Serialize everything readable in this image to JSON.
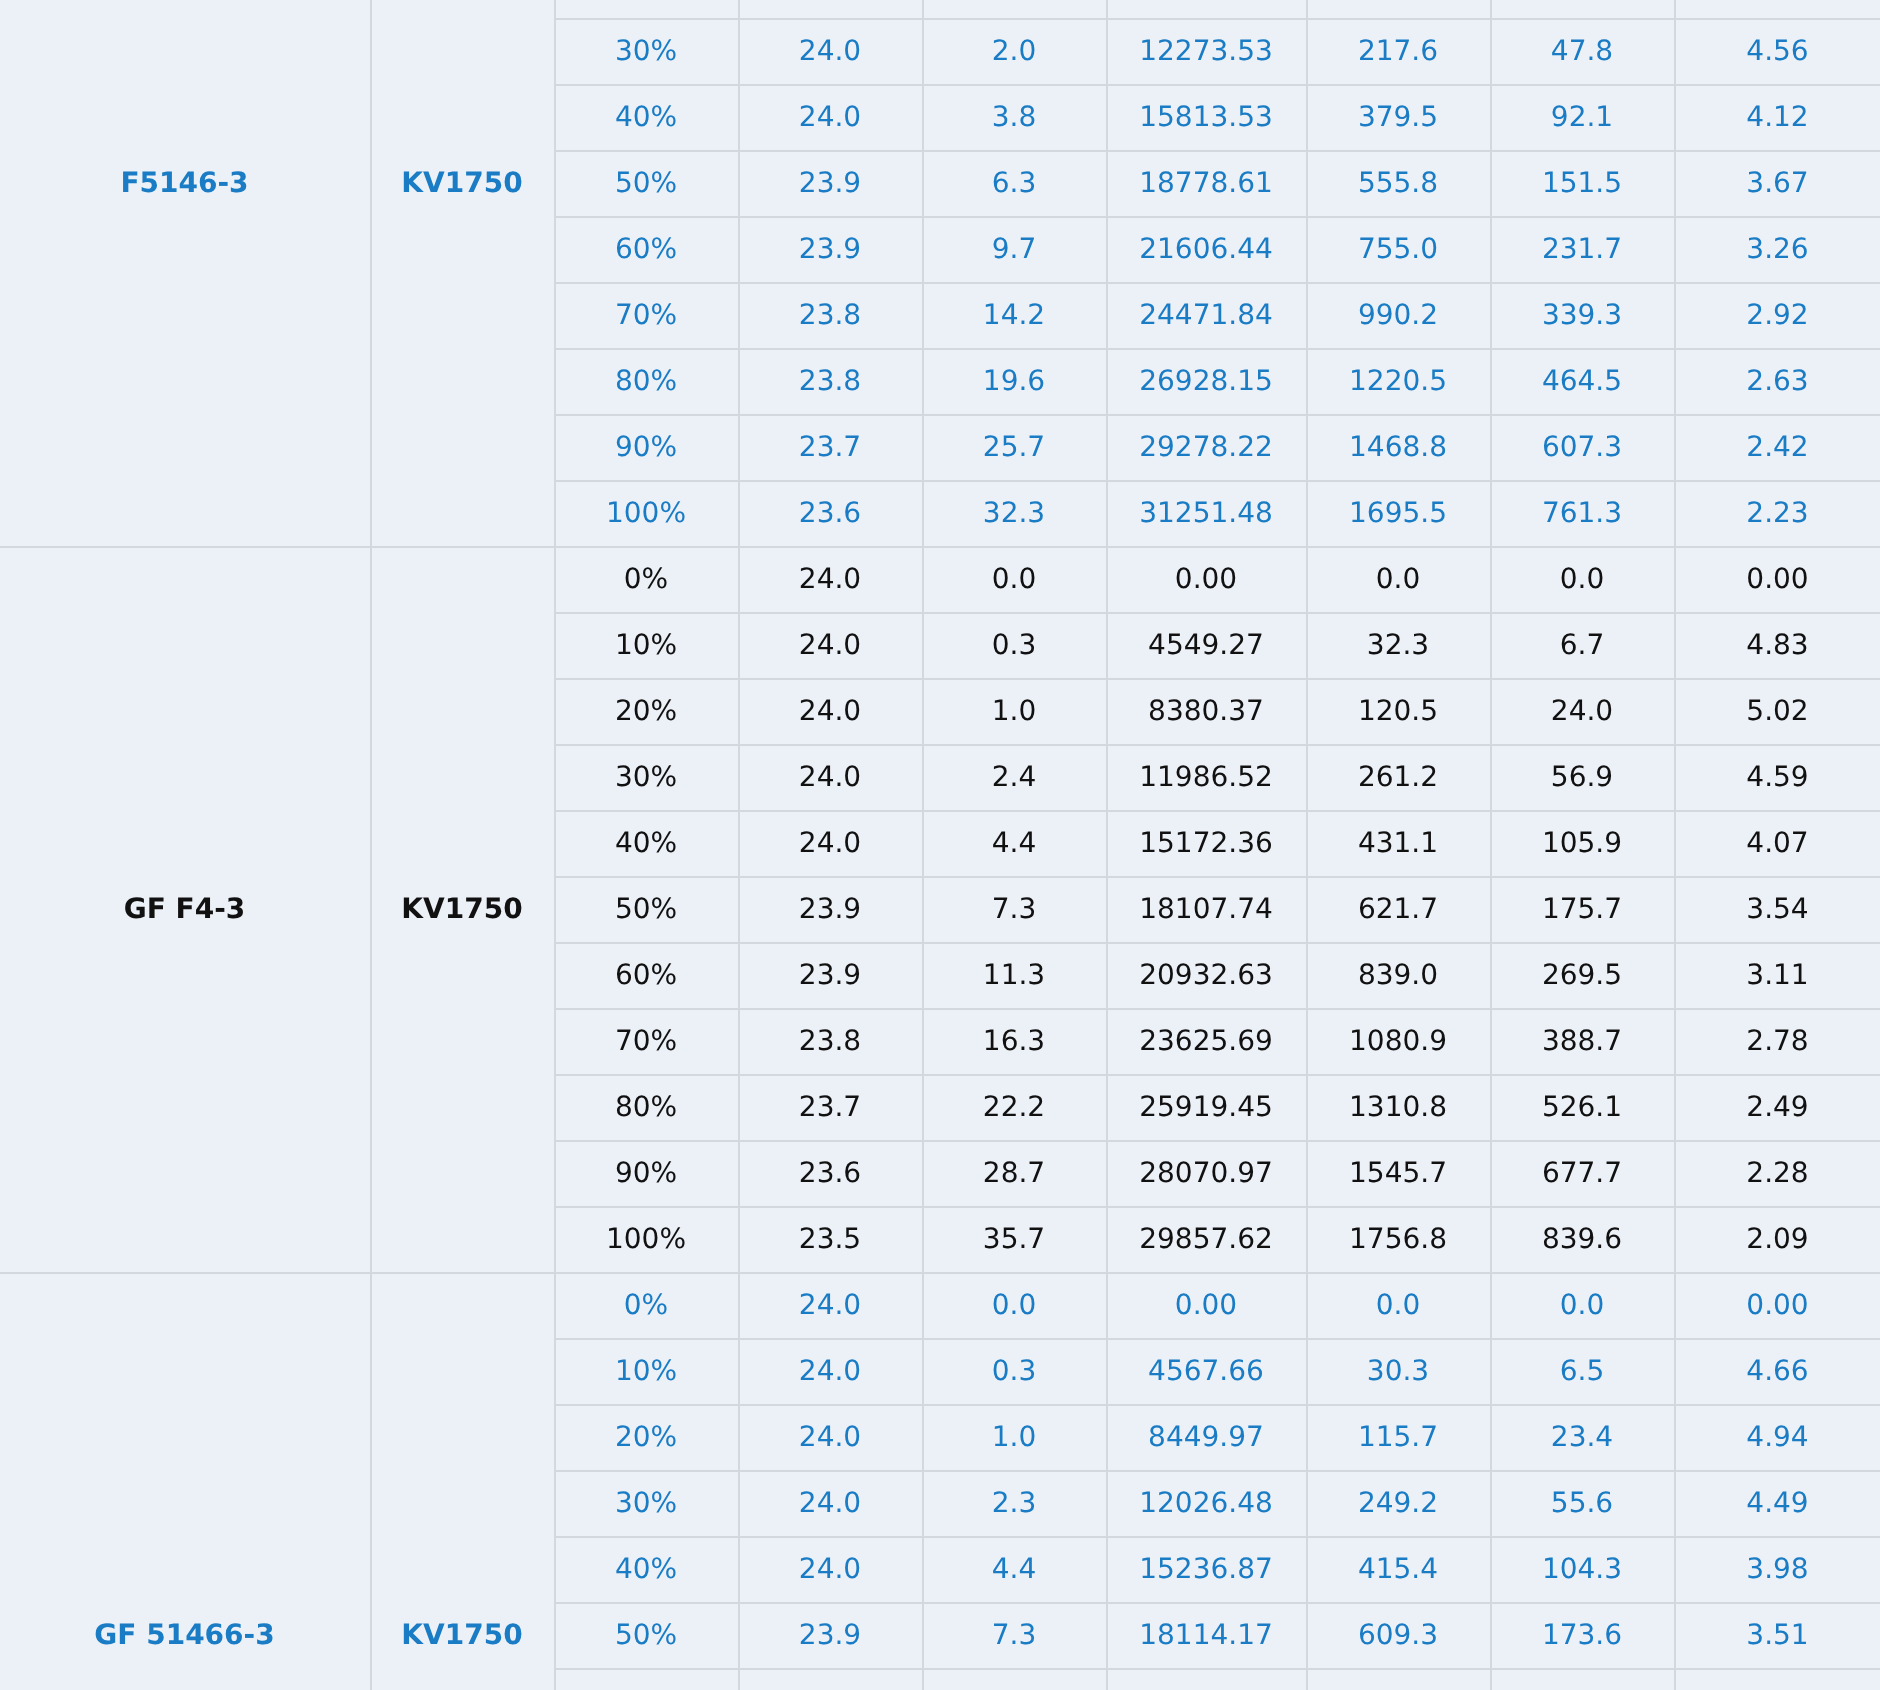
{
  "table": {
    "groups": [
      {
        "model": "F5146-3",
        "variant": "KV1750",
        "color": "#1a7cc4",
        "rows": [
          [
            "30%",
            "24.0",
            "2.0",
            "12273.53",
            "217.6",
            "47.8",
            "4.56"
          ],
          [
            "40%",
            "24.0",
            "3.8",
            "15813.53",
            "379.5",
            "92.1",
            "4.12"
          ],
          [
            "50%",
            "23.9",
            "6.3",
            "18778.61",
            "555.8",
            "151.5",
            "3.67"
          ],
          [
            "60%",
            "23.9",
            "9.7",
            "21606.44",
            "755.0",
            "231.7",
            "3.26"
          ],
          [
            "70%",
            "23.8",
            "14.2",
            "24471.84",
            "990.2",
            "339.3",
            "2.92"
          ],
          [
            "80%",
            "23.8",
            "19.6",
            "26928.15",
            "1220.5",
            "464.5",
            "2.63"
          ],
          [
            "90%",
            "23.7",
            "25.7",
            "29278.22",
            "1468.8",
            "607.3",
            "2.42"
          ],
          [
            "100%",
            "23.6",
            "32.3",
            "31251.48",
            "1695.5",
            "761.3",
            "2.23"
          ]
        ]
      },
      {
        "model": "GF F4-3",
        "variant": "KV1750",
        "color": "#111111",
        "rows": [
          [
            "0%",
            "24.0",
            "0.0",
            "0.00",
            "0.0",
            "0.0",
            "0.00"
          ],
          [
            "10%",
            "24.0",
            "0.3",
            "4549.27",
            "32.3",
            "6.7",
            "4.83"
          ],
          [
            "20%",
            "24.0",
            "1.0",
            "8380.37",
            "120.5",
            "24.0",
            "5.02"
          ],
          [
            "30%",
            "24.0",
            "2.4",
            "11986.52",
            "261.2",
            "56.9",
            "4.59"
          ],
          [
            "40%",
            "24.0",
            "4.4",
            "15172.36",
            "431.1",
            "105.9",
            "4.07"
          ],
          [
            "50%",
            "23.9",
            "7.3",
            "18107.74",
            "621.7",
            "175.7",
            "3.54"
          ],
          [
            "60%",
            "23.9",
            "11.3",
            "20932.63",
            "839.0",
            "269.5",
            "3.11"
          ],
          [
            "70%",
            "23.8",
            "16.3",
            "23625.69",
            "1080.9",
            "388.7",
            "2.78"
          ],
          [
            "80%",
            "23.7",
            "22.2",
            "25919.45",
            "1310.8",
            "526.1",
            "2.49"
          ],
          [
            "90%",
            "23.6",
            "28.7",
            "28070.97",
            "1545.7",
            "677.7",
            "2.28"
          ],
          [
            "100%",
            "23.5",
            "35.7",
            "29857.62",
            "1756.8",
            "839.6",
            "2.09"
          ]
        ]
      },
      {
        "model": "GF 51466-3",
        "variant": "KV1750",
        "color": "#1a7cc4",
        "rows": [
          [
            "0%",
            "24.0",
            "0.0",
            "0.00",
            "0.0",
            "0.0",
            "0.00"
          ],
          [
            "10%",
            "24.0",
            "0.3",
            "4567.66",
            "30.3",
            "6.5",
            "4.66"
          ],
          [
            "20%",
            "24.0",
            "1.0",
            "8449.97",
            "115.7",
            "23.4",
            "4.94"
          ],
          [
            "30%",
            "24.0",
            "2.3",
            "12026.48",
            "249.2",
            "55.6",
            "4.49"
          ],
          [
            "40%",
            "24.0",
            "4.4",
            "15236.87",
            "415.4",
            "104.3",
            "3.98"
          ],
          [
            "50%",
            "23.9",
            "7.3",
            "18114.17",
            "609.3",
            "173.6",
            "3.51"
          ]
        ]
      }
    ]
  }
}
